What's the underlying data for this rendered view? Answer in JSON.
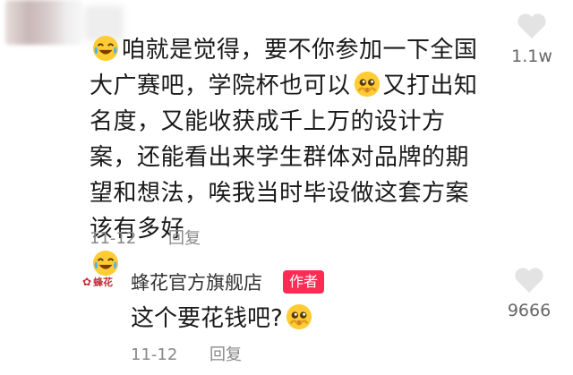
{
  "comment": {
    "text_segments": [
      {
        "type": "emoji",
        "name": "laugh-cry-emoji"
      },
      {
        "type": "text",
        "value": "咱就是觉得，要不你参加一下全国大广赛吧，学院杯也可以"
      },
      {
        "type": "emoji",
        "name": "pleading-face-emoji"
      },
      {
        "type": "text",
        "value": "又打出知名度，又能收获成千上万的设计方案，还能看出来学生群体对品牌的期望和想法，唉我当时毕设做这套方案该有多好"
      },
      {
        "type": "emoji",
        "name": "laugh-cry-emoji"
      }
    ],
    "date": "11-12",
    "reply_label": "回复",
    "like_icon": "heart-icon",
    "like_count": "1.1w"
  },
  "reply": {
    "shop_logo_text": "蜂花",
    "shop_name": "蜂花官方旗舰店",
    "author_badge": "作者",
    "text": "这个要花钱吧?",
    "emoji": "pleading-face-emoji",
    "date": "11-12",
    "reply_label": "回复",
    "like_icon": "heart-icon",
    "like_count": "9666"
  },
  "colors": {
    "author_badge_bg": "#fe2c55",
    "heart": "#e3e3e3",
    "meta_text": "#888888",
    "shop_logo": "#c02f3a"
  }
}
